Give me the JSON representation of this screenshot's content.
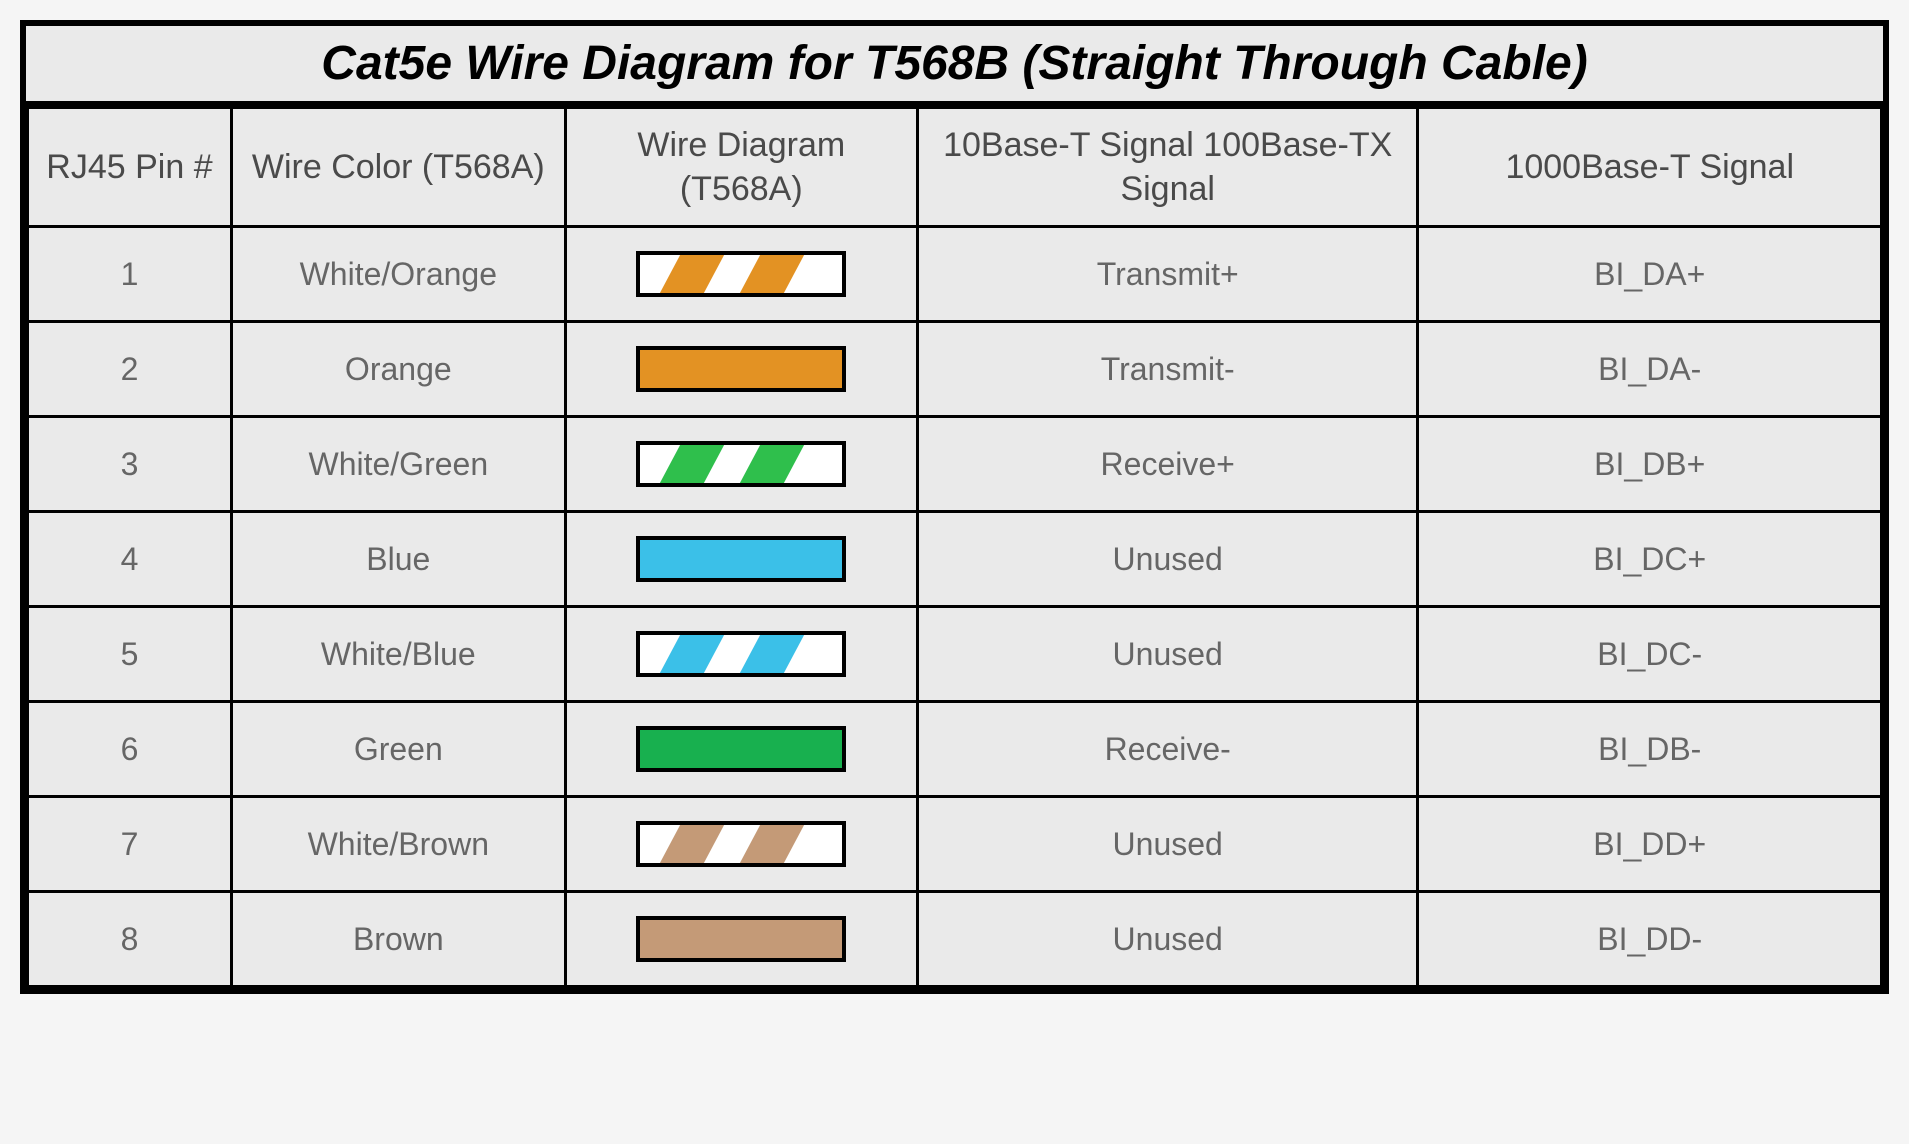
{
  "title": "Cat5e Wire Diagram for T568B (Straight Through Cable)",
  "headers": {
    "pin": "RJ45 Pin #",
    "color": "Wire Color (T568A)",
    "diagram": "Wire Diagram (T568A)",
    "signal10": "10Base-T Signal 100Base-TX Signal",
    "signal1000": "1000Base-T Signal"
  },
  "colors": {
    "orange": "#E39223",
    "green": "#2FBF4C",
    "blue": "#3BC0E8",
    "deepgreen": "#18B04F",
    "brown": "#C49A77",
    "white": "#FFFFFF"
  },
  "rows": [
    {
      "pin": "1",
      "colorName": "White/Orange",
      "swatch": {
        "type": "striped",
        "stripe": "#E39223"
      },
      "sig10": "Transmit+",
      "sig1000": "BI_DA+"
    },
    {
      "pin": "2",
      "colorName": "Orange",
      "swatch": {
        "type": "solid",
        "fill": "#E39223"
      },
      "sig10": "Transmit-",
      "sig1000": "BI_DA-"
    },
    {
      "pin": "3",
      "colorName": "White/Green",
      "swatch": {
        "type": "striped",
        "stripe": "#2FBF4C"
      },
      "sig10": "Receive+",
      "sig1000": "BI_DB+"
    },
    {
      "pin": "4",
      "colorName": "Blue",
      "swatch": {
        "type": "solid",
        "fill": "#3BC0E8"
      },
      "sig10": "Unused",
      "sig1000": "BI_DC+"
    },
    {
      "pin": "5",
      "colorName": "White/Blue",
      "swatch": {
        "type": "striped",
        "stripe": "#3BC0E8"
      },
      "sig10": "Unused",
      "sig1000": "BI_DC-"
    },
    {
      "pin": "6",
      "colorName": "Green",
      "swatch": {
        "type": "solid",
        "fill": "#18B04F"
      },
      "sig10": "Receive-",
      "sig1000": "BI_DB-"
    },
    {
      "pin": "7",
      "colorName": "White/Brown",
      "swatch": {
        "type": "striped",
        "stripe": "#C49A77"
      },
      "sig10": "Unused",
      "sig1000": "BI_DD+"
    },
    {
      "pin": "8",
      "colorName": "Brown",
      "swatch": {
        "type": "solid",
        "fill": "#C49A77"
      },
      "sig10": "Unused",
      "sig1000": "BI_DD-"
    }
  ]
}
